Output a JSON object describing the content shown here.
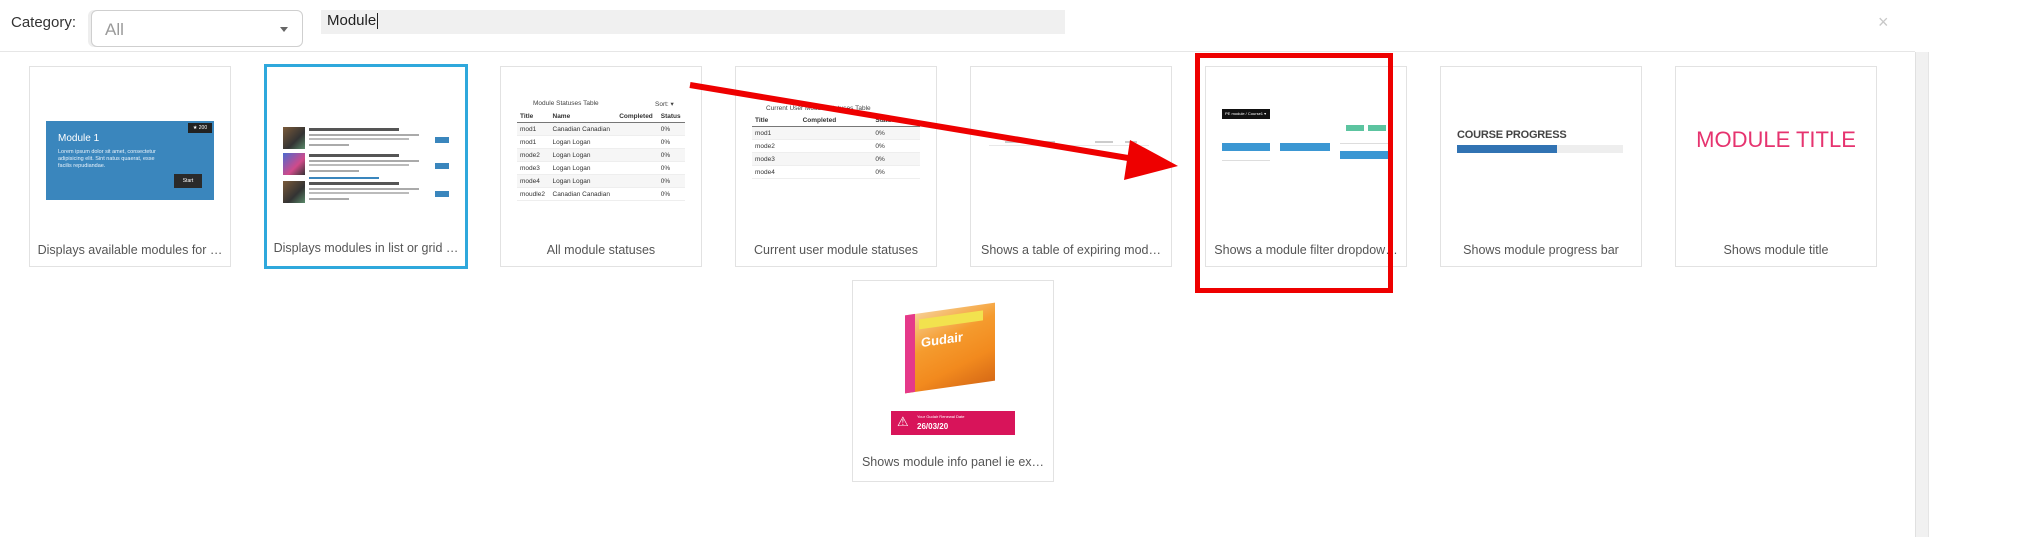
{
  "header": {
    "category_label": "Category:",
    "category_value": "All",
    "search_value": "Module",
    "close_symbol": "×"
  },
  "cards": [
    {
      "caption": "Displays available modules for …",
      "thumb": {
        "title": "Module 1",
        "text": "Lorem ipsum dolor sit amet, consectetur adipisicing elit. Sint natus quaerat, esse facilis repudiandae.",
        "badge": "★ 200",
        "button": "Start"
      }
    },
    {
      "caption": "Displays modules in list or grid …",
      "selected": true
    },
    {
      "caption": "All module statuses",
      "thumb": {
        "title": "Module Statuses Table",
        "sort": "Sort: ▾",
        "headers": [
          "Title",
          "Name",
          "Completed",
          "Status"
        ],
        "rows": [
          [
            "mod1",
            "Canadian Canadian",
            "",
            "0%"
          ],
          [
            "mod1",
            "Logan Logan",
            "",
            "0%"
          ],
          [
            "mode2",
            "Logan Logan",
            "",
            "0%"
          ],
          [
            "mode3",
            "Logan Logan",
            "",
            "0%"
          ],
          [
            "mode4",
            "Logan Logan",
            "",
            "0%"
          ],
          [
            "moudle2",
            "Canadian Canadian",
            "",
            "0%"
          ]
        ]
      }
    },
    {
      "caption": "Current user module statuses",
      "thumb": {
        "title": "Current User Module Statuses Table",
        "headers": [
          "Title",
          "Completed",
          "Status"
        ],
        "rows": [
          [
            "mod1",
            "",
            "0%"
          ],
          [
            "mode2",
            "",
            "0%"
          ],
          [
            "mode3",
            "",
            "0%"
          ],
          [
            "mode4",
            "",
            "0%"
          ]
        ]
      }
    },
    {
      "caption": "Shows a table of expiring mod…"
    },
    {
      "caption": "Shows a module filter dropdow…",
      "thumb": {
        "bar_text": "PE module / Course1 ▾"
      }
    },
    {
      "caption": "Shows module progress bar",
      "thumb": {
        "title": "COURSE PROGRESS",
        "progress": 0.6
      }
    },
    {
      "caption": "Shows module title",
      "thumb": {
        "title": "MODULE TITLE"
      }
    },
    {
      "caption": "Shows module info panel ie ex…",
      "thumb": {
        "brand": "Gudair",
        "small_text": "Your Gudair Renewal Date",
        "date": "26/03/20"
      }
    }
  ],
  "colors": {
    "accent_blue": "#2fa8dc",
    "highlight_red": "#ee0000",
    "module_blue": "#3a86bd",
    "title_pink": "#e6336f",
    "info_red": "#d8145a"
  }
}
